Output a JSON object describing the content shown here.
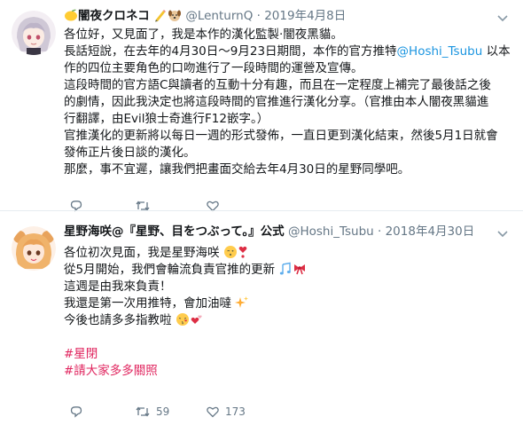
{
  "tweets": [
    {
      "name": "闇夜クロネコ",
      "handle": "@LenturnQ",
      "separator": "·",
      "date": "2019年4月8日",
      "lines": [
        [
          "各位好，又見面了，我是本作的漢化監製·闇夜黑貓。"
        ],
        [
          "長話短說，在去年的4月30日～9月23日期間，本作的官方推特",
          "@Hoshi_Tsubu",
          " 以本"
        ],
        [
          "作的四位主要角色的口吻進行了一段時間的運營及宣傳。"
        ],
        [
          "這段時間的官方語C與讀者的互動十分有趣，而且在一定程度上補完了最後話之後"
        ],
        [
          "的劇情，因此我決定也將這段時間的官推進行漢化分享。（官推由本人闇夜黑貓進"
        ],
        [
          "行翻譯，由Evil狼士奇進行F12嵌字。）"
        ],
        [
          "官推漢化的更新將以每日一週的形式發佈，一直日更到漢化結束，然後5月1日就會"
        ],
        [
          "發佈正片後日談的漢化。"
        ],
        [
          "那麼，事不宜遲，讓我們把畫面交給去年4月30日的星野同學吧。"
        ]
      ],
      "counts": {
        "reply": "",
        "retweet": "",
        "like": ""
      }
    },
    {
      "name": "星野海咲@『星野、目をつぶって。』公式",
      "handle": "@Hoshi_Tsubu",
      "separator": "·",
      "date": "2018年4月30日",
      "lines": [
        "各位初次見面，我是星野海咲",
        "從5月開始，我們會輪流負責官推的更新",
        "這週是由我來負責！",
        "我還是第一次用推特，會加油噠",
        "今後也請多多指教啦",
        "",
        "#星閉",
        "#請大家多多關照"
      ],
      "counts": {
        "reply": "",
        "retweet": "59",
        "like": "173"
      }
    }
  ],
  "icons": {
    "reply": "reply-icon",
    "retweet": "retweet-icon",
    "like": "heart-icon",
    "caret": "chevron-down-icon",
    "emojis": [
      "lemon-emoji",
      "pencil-emoji",
      "dog-face-emoji",
      "kissing-face-emoji",
      "heart-exclamation-emoji",
      "musical-notes-emoji",
      "ribbon-emoji",
      "sparkles-emoji",
      "kiss-face-emoji",
      "two-hearts-emoji"
    ]
  },
  "colors": {
    "link": "#1b95e0",
    "hashtag": "#e0245e",
    "secondary": "#657786",
    "divider": "#e6ecf0"
  }
}
